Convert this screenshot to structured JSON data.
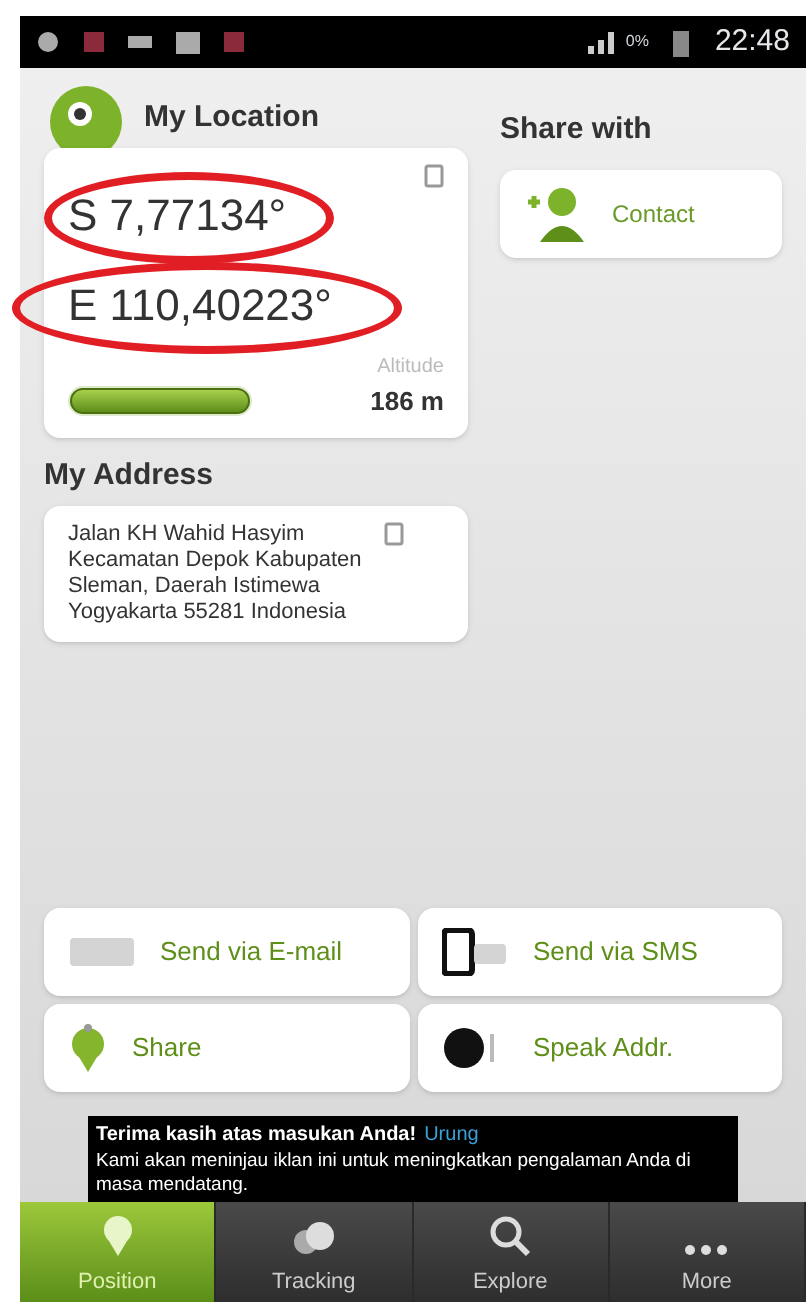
{
  "status_bar": {
    "battery": "0%",
    "time": "22:48"
  },
  "location": {
    "title": "My Location",
    "latitude": "S 7,77134°",
    "longitude": "E 110,40223°",
    "altitude_label": "Altitude",
    "accuracy": {
      "level": 1
    },
    "altitude": "186 m"
  },
  "share": {
    "title": "Share with",
    "contact": "Contact"
  },
  "address": {
    "title": "My Address",
    "text": "Jalan KH Wahid Hasyim Kecamatan Depok Kabupaten Sleman, Daerah Istimewa Yogyakarta 55281 Indonesia"
  },
  "actions": [
    {
      "kind": "email",
      "label": "Send via E-mail"
    },
    {
      "kind": "sms",
      "label": "Send via SMS"
    },
    {
      "kind": "share",
      "label": "Share"
    },
    {
      "kind": "speak",
      "label": "Speak Addr."
    }
  ],
  "ad_notice": {
    "title": "Terima kasih atas masukan Anda!",
    "link": "Urung",
    "body": "Kami akan meninjau iklan ini untuk meningkatkan pengalaman Anda di masa mendatang."
  },
  "nav": [
    {
      "kind": "pin",
      "label": "Position",
      "selected": true
    },
    {
      "kind": "tracking",
      "label": "Tracking",
      "selected": false
    },
    {
      "kind": "search",
      "label": "Explore",
      "selected": false
    },
    {
      "kind": "more",
      "label": "More",
      "selected": false
    }
  ]
}
